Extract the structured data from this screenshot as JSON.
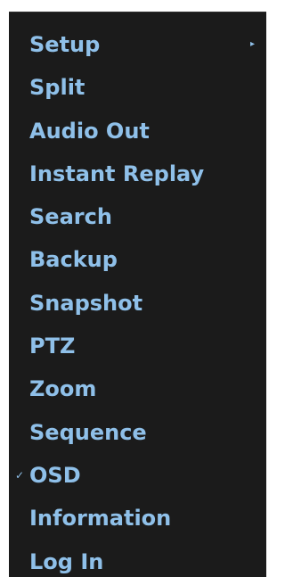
{
  "menu": {
    "items": [
      {
        "label": "Setup",
        "has_submenu": true,
        "checked": false
      },
      {
        "label": "Split",
        "has_submenu": false,
        "checked": false
      },
      {
        "label": "Audio Out",
        "has_submenu": false,
        "checked": false
      },
      {
        "label": "Instant Replay",
        "has_submenu": false,
        "checked": false
      },
      {
        "label": "Search",
        "has_submenu": false,
        "checked": false
      },
      {
        "label": "Backup",
        "has_submenu": false,
        "checked": false
      },
      {
        "label": "Snapshot",
        "has_submenu": false,
        "checked": false
      },
      {
        "label": "PTZ",
        "has_submenu": false,
        "checked": false
      },
      {
        "label": "Zoom",
        "has_submenu": false,
        "checked": false
      },
      {
        "label": "Sequence",
        "has_submenu": false,
        "checked": false
      },
      {
        "label": "OSD",
        "has_submenu": false,
        "checked": true
      },
      {
        "label": "Information",
        "has_submenu": false,
        "checked": false
      },
      {
        "label": "Log In",
        "has_submenu": false,
        "checked": false
      }
    ],
    "submenu_arrow_icon": "chevron-right-icon",
    "check_icon": "checkmark-icon",
    "colors": {
      "background": "#1b1b1b",
      "text": "#8fc0e9",
      "page": "#ffffff"
    }
  }
}
